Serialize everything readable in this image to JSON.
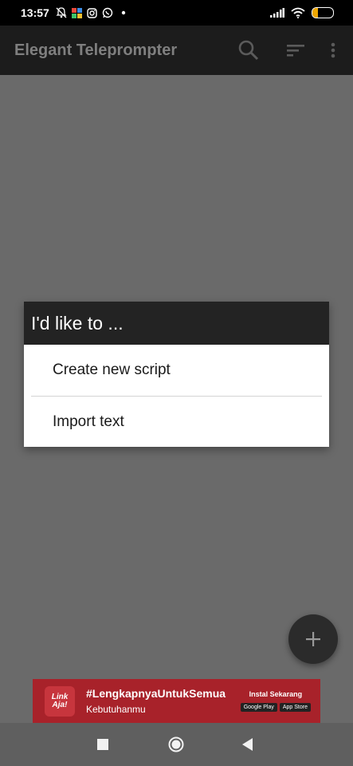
{
  "status_bar": {
    "time": "13:57",
    "battery_level": "27",
    "icons": [
      "mute-bell-icon",
      "photos-icon",
      "instagram-icon",
      "whatsapp-icon",
      "notification-dot-icon",
      "signal-icon",
      "wifi-icon",
      "battery-icon"
    ]
  },
  "app_bar": {
    "title": "Elegant Teleprompter",
    "actions": [
      "search-icon",
      "sort-icon",
      "more-vert-icon"
    ]
  },
  "dialog": {
    "title": "I'd like to ...",
    "options": [
      {
        "label": "Create new script"
      },
      {
        "label": "Import text"
      }
    ]
  },
  "fab": {
    "icon": "plus-icon"
  },
  "ad": {
    "logo_text": "Link Aja!",
    "headline": "#LengkapnyaUntukSemua",
    "subline": "Kebutuhanmu",
    "cta": "Instal Sekarang",
    "stores": [
      "Google Play",
      "App Store"
    ]
  },
  "nav_bar": {
    "buttons": [
      "recents-square-icon",
      "home-circle-icon",
      "back-triangle-icon"
    ]
  },
  "colors": {
    "scrim": "#6a6a6a",
    "app_bar": "#1c1c1c",
    "dialog_header": "#232323",
    "ad_background": "#a8222a"
  }
}
